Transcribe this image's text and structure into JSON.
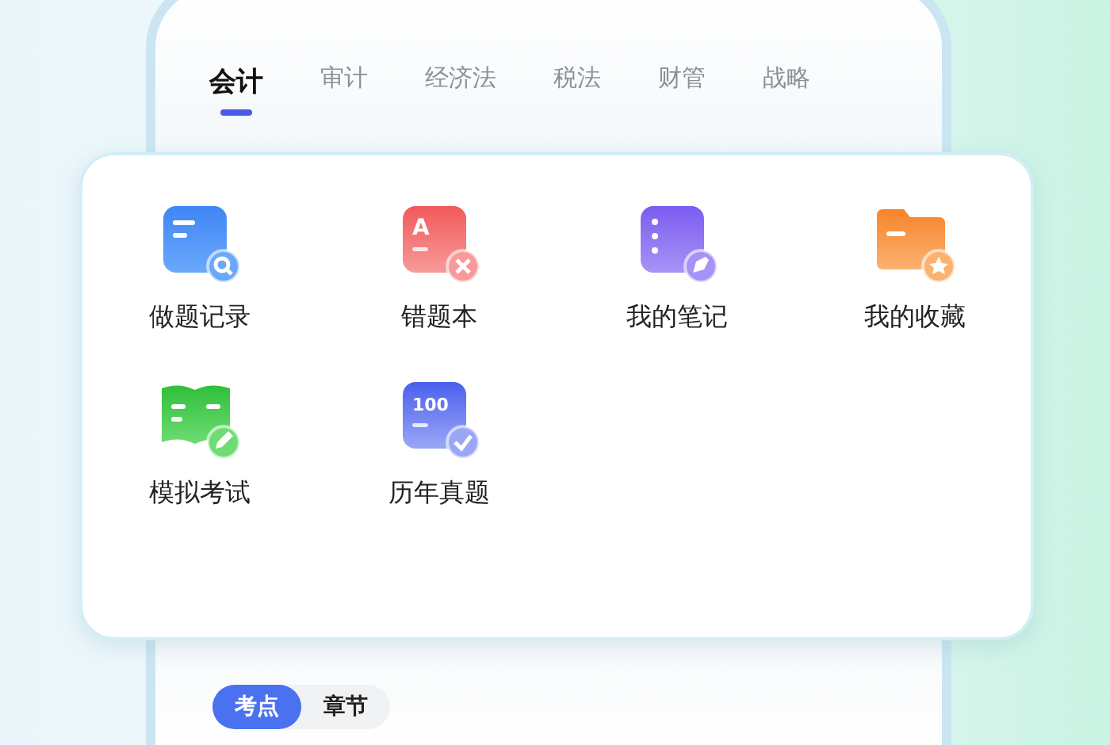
{
  "tabs": [
    {
      "label": "会计",
      "selected": true
    },
    {
      "label": "审计",
      "selected": false
    },
    {
      "label": "经济法",
      "selected": false
    },
    {
      "label": "税法",
      "selected": false
    },
    {
      "label": "财管",
      "selected": false
    },
    {
      "label": "战略",
      "selected": false
    }
  ],
  "tools": [
    {
      "kind": "record",
      "label": "做题记录"
    },
    {
      "kind": "wrong",
      "label": "错题本",
      "icon_text": "A"
    },
    {
      "kind": "notes",
      "label": "我的笔记"
    },
    {
      "kind": "favorites",
      "label": "我的收藏"
    },
    {
      "kind": "exam",
      "label": "模拟考试"
    },
    {
      "kind": "past",
      "label": "历年真题",
      "icon_text": "100"
    }
  ],
  "filters": [
    {
      "label": "考点",
      "selected": true
    },
    {
      "label": "章节",
      "selected": false
    }
  ]
}
